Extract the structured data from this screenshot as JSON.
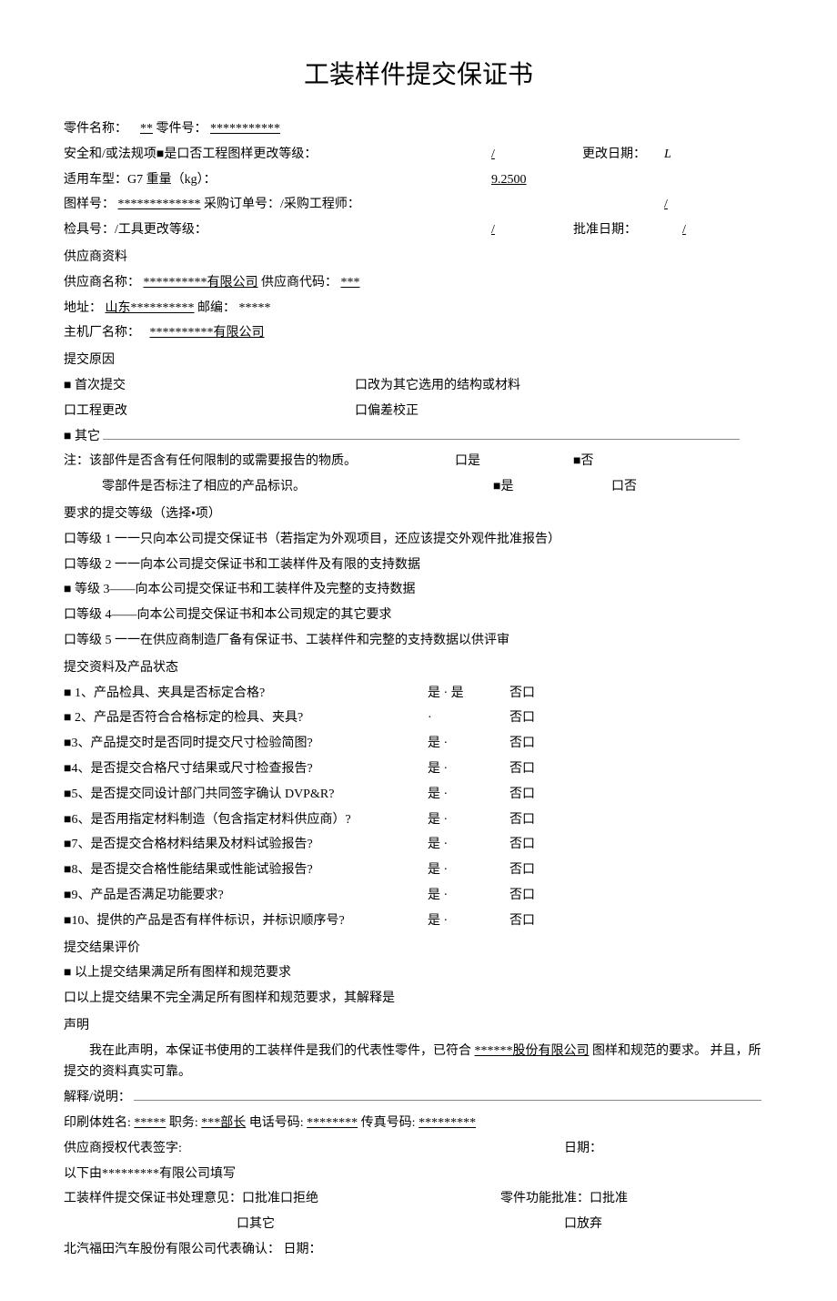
{
  "title": "工装样件提交保证书",
  "part": {
    "name_label": "零件名称：",
    "name_value": "**",
    "no_label": "零件号：",
    "no_value": "***********"
  },
  "safety": {
    "label_a": "安全和/或法规项■是口否工程图样更改等级：",
    "slash1": "/",
    "change_date_label": "更改日期：",
    "change_date_value": "L"
  },
  "model": {
    "label": "适用车型：G7 重量（kg）：",
    "value": "9.2500"
  },
  "drawing": {
    "label": "图样号：",
    "value": "*************",
    "po_label": "采购订单号：/采购工程师：",
    "slash": "/"
  },
  "gauge": {
    "label": "检具号：/工具更改等级：",
    "slash": "/",
    "approve_label": "批准日期：",
    "approve_slash": "/"
  },
  "supplier": {
    "header": "供应商资料",
    "name_label": "供应商名称：",
    "name_value": "**********有限公司",
    "code_label": "供应商代码：",
    "code_value": "***",
    "addr_label": "地址：",
    "addr_value": "山东**********",
    "zip_label": "邮编：",
    "zip_value": "*****",
    "oem_label": "主机厂名称：",
    "oem_value": "**********有限公司"
  },
  "reason": {
    "header": "提交原因",
    "r1": "■  首次提交",
    "r2": "口改为其它选用的结构或材料",
    "r3": "口工程更改",
    "r4": "口偏差校正",
    "r5": "■  其它"
  },
  "restricted": {
    "q1": "注：该部件是否含有任何限制的或需要报告的物质。",
    "q1yes": "口是",
    "q1no": "■否",
    "q2": "零部件是否标注了相应的产品标识。",
    "q2yes": "■是",
    "q2no": "口否"
  },
  "level": {
    "header": "要求的提交等级（选择•项）",
    "l1": "口等级 1 一一只向本公司提交保证书（若指定为外观项目，还应该提交外观件批准报告）",
    "l2": "口等级 2 一一向本公司提交保证书和工装样件及有限的支持数据",
    "l3": "■  等级 3——向本公司提交保证书和工装样件及完整的支持数据",
    "l4": "口等级 4——向本公司提交保证书和本公司规定的其它要求",
    "l5": "口等级 5 一一在供应商制造厂备有保证书、工装样件和完整的支持数据以供评审"
  },
  "status": {
    "header": "提交资料及产品状态",
    "items": [
      {
        "q": "■  1、产品检具、夹具是否标定合格?",
        "y": "是 · 是",
        "n": "否口"
      },
      {
        "q": "■  2、产品是否符合合格标定的检具、夹具?",
        "y": "·",
        "n": "否口"
      },
      {
        "q": "■3、产品提交时是否同时提交尺寸检验简图?",
        "y": "是 ·",
        "n": "否口"
      },
      {
        "q": "■4、是否提交合格尺寸结果或尺寸检查报告?",
        "y": "是 ·",
        "n": "否口"
      },
      {
        "q": "■5、是否提交同设计部门共同签字确认 DVP&R?",
        "y": "是 ·",
        "n": "否口"
      },
      {
        "q": "■6、是否用指定材料制造（包含指定材料供应商）?",
        "y": "是 ·",
        "n": "否口"
      },
      {
        "q": "■7、是否提交合格材料结果及材料试验报告?",
        "y": "是 ·",
        "n": "否口"
      },
      {
        "q": "■8、是否提交合格性能结果或性能试验报告?",
        "y": "是 ·",
        "n": "否口"
      },
      {
        "q": "■9、产品是否满足功能要求?",
        "y": "是 ·",
        "n": "否口"
      },
      {
        "q": "■10、提供的产品是否有样件标识，并标识顺序号?",
        "y": "是 ·",
        "n": "否口"
      }
    ]
  },
  "result": {
    "header": "提交结果评价",
    "r1": "■  以上提交结果满足所有图样和规范要求",
    "r2": "口以上提交结果不完全满足所有图样和规范要求，其解释是"
  },
  "decl": {
    "header": "声明",
    "body1": "我在此声明，本保证书使用的工装样件是我们的代表性零件，已符合",
    "company": "******股份有限公司",
    "body2": "图样和规范的要求。 并且，所提交的资料真实可靠。",
    "explain_label": "解释/说明："
  },
  "sign": {
    "print_label": "印刷体姓名:",
    "print_value": "*****",
    "title_label": "职务:",
    "title_value": "***部长",
    "tel_label": "电话号码:",
    "tel_value": "********",
    "fax_label": "传真号码:",
    "fax_value": "*********",
    "auth_label": "供应商授权代表签字:",
    "date_label": "日期：",
    "below_label": "以下由*********有限公司填写",
    "opinion_label": "工装样件提交保证书处理意见：口批准口拒绝",
    "func_label": "零件功能批准：口批准",
    "other_label": "口其它",
    "abandon_label": "口放弃",
    "confirm_label": "北汽福田汽车股份有限公司代表确认： 日期："
  }
}
